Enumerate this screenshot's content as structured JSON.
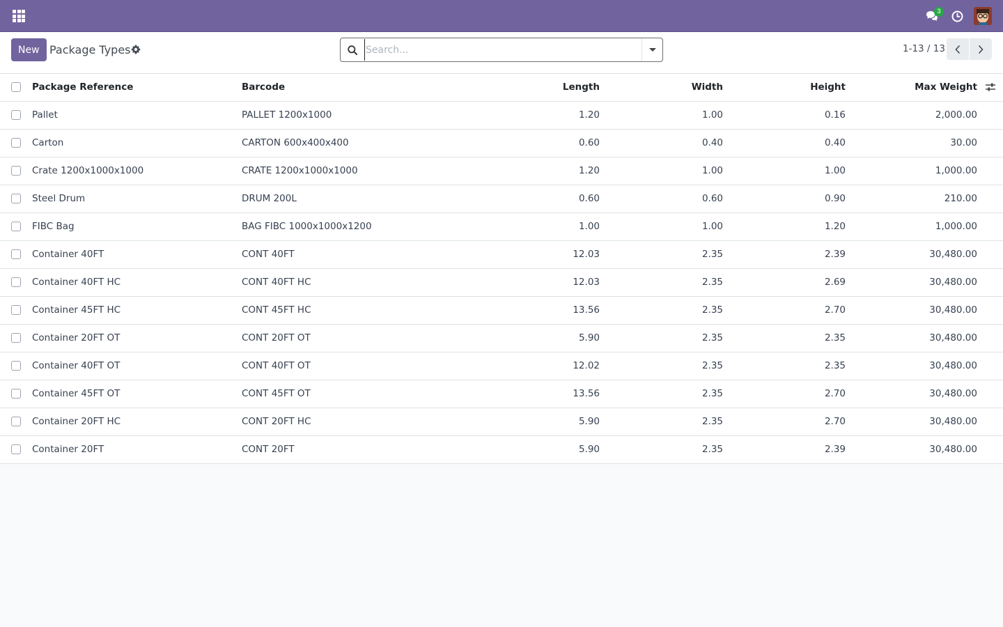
{
  "navbar": {
    "messages_badge": "3"
  },
  "control": {
    "new_label": "New",
    "title": "Package Types",
    "search_placeholder": "Search...",
    "pager": "1-13 / 13"
  },
  "table": {
    "headers": {
      "reference": "Package Reference",
      "barcode": "Barcode",
      "length": "Length",
      "width": "Width",
      "height": "Height",
      "max_weight": "Max Weight"
    },
    "rows": [
      {
        "reference": "Pallet",
        "barcode": "PALLET 1200x1000",
        "length": "1.20",
        "width": "1.00",
        "height": "0.16",
        "max_weight": "2,000.00"
      },
      {
        "reference": "Carton",
        "barcode": "CARTON 600x400x400",
        "length": "0.60",
        "width": "0.40",
        "height": "0.40",
        "max_weight": "30.00"
      },
      {
        "reference": "Crate 1200x1000x1000",
        "barcode": "CRATE 1200x1000x1000",
        "length": "1.20",
        "width": "1.00",
        "height": "1.00",
        "max_weight": "1,000.00"
      },
      {
        "reference": "Steel Drum",
        "barcode": "DRUM 200L",
        "length": "0.60",
        "width": "0.60",
        "height": "0.90",
        "max_weight": "210.00"
      },
      {
        "reference": "FIBC Bag",
        "barcode": "BAG FIBC 1000x1000x1200",
        "length": "1.00",
        "width": "1.00",
        "height": "1.20",
        "max_weight": "1,000.00"
      },
      {
        "reference": "Container 40FT",
        "barcode": "CONT 40FT",
        "length": "12.03",
        "width": "2.35",
        "height": "2.39",
        "max_weight": "30,480.00"
      },
      {
        "reference": "Container 40FT HC",
        "barcode": "CONT 40FT HC",
        "length": "12.03",
        "width": "2.35",
        "height": "2.69",
        "max_weight": "30,480.00"
      },
      {
        "reference": "Container 45FT HC",
        "barcode": "CONT 45FT HC",
        "length": "13.56",
        "width": "2.35",
        "height": "2.70",
        "max_weight": "30,480.00"
      },
      {
        "reference": "Container 20FT OT",
        "barcode": "CONT 20FT OT",
        "length": "5.90",
        "width": "2.35",
        "height": "2.35",
        "max_weight": "30,480.00"
      },
      {
        "reference": "Container 40FT OT",
        "barcode": "CONT 40FT OT",
        "length": "12.02",
        "width": "2.35",
        "height": "2.35",
        "max_weight": "30,480.00"
      },
      {
        "reference": "Container 45FT OT",
        "barcode": "CONT 45FT OT",
        "length": "13.56",
        "width": "2.35",
        "height": "2.70",
        "max_weight": "30,480.00"
      },
      {
        "reference": "Container 20FT HC",
        "barcode": "CONT 20FT HC",
        "length": "5.90",
        "width": "2.35",
        "height": "2.70",
        "max_weight": "30,480.00"
      },
      {
        "reference": "Container 20FT",
        "barcode": "CONT 20FT",
        "length": "5.90",
        "width": "2.35",
        "height": "2.39",
        "max_weight": "30,480.00"
      }
    ]
  }
}
